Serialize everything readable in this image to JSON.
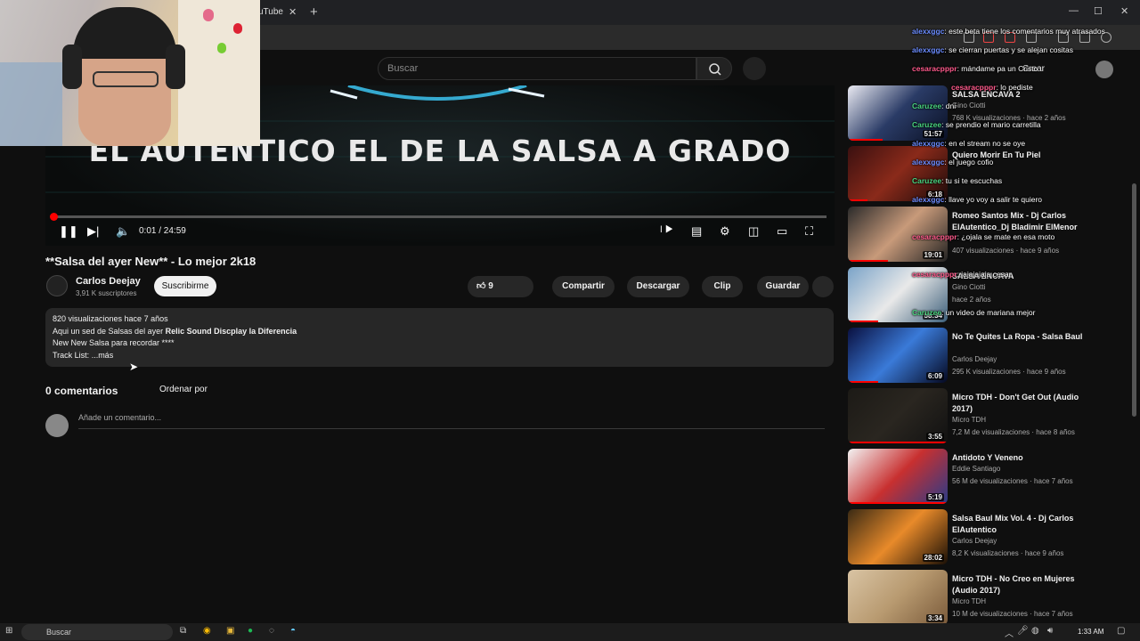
{
  "browser": {
    "tab_title": "uTube",
    "tab_close": "✕",
    "new_tab": "+",
    "win_min": "—",
    "win_max": "☐",
    "win_close": "✕"
  },
  "header": {
    "search_placeholder": "Buscar",
    "create_label": "Crear"
  },
  "player": {
    "banner_text": "EL AUTENTICO EL DE LA SALSA A GRADO",
    "time_display": "0:01 / 24:59",
    "progress_fraction": 0.0007
  },
  "video": {
    "title": "**Salsa del ayer New** - Lo mejor 2k18",
    "channel": "Carlos Deejay",
    "subscribers": "3,91 K suscriptores",
    "subscribe_label": "Suscribirme",
    "like_count": "9",
    "share_label": "Compartir",
    "download_label": "Descargar",
    "clip_label": "Clip",
    "save_label": "Guardar"
  },
  "description": {
    "stats": "820 visualizaciones  hace 7 años",
    "line1_prefix": "Aqui un sed de Salsas del ayer ",
    "line1_bold": "Relic Sound Discplay la Diferencia",
    "line2": "New New Salsa para recordar ****",
    "line3_prefix": "Track List: ",
    "more": "...más"
  },
  "comments": {
    "count_label": "0 comentarios",
    "sort_label": "Ordenar por",
    "input_placeholder": "Añade un comentario..."
  },
  "recommendations": [
    {
      "title": "SALSA ENCAVA 2",
      "channel": "Gino Ciotti",
      "meta": "768 K visualizaciones · hace 2 años",
      "duration": "51:57",
      "progress": 0.35
    },
    {
      "title": "Quiero Morir En Tu Piel",
      "channel": "",
      "meta": "",
      "duration": "6:18",
      "progress": 0.2
    },
    {
      "title": "Romeo Santos Mix - Dj Carlos ElAutentico_Dj Bladimir ElMenor",
      "channel": "",
      "meta": "407 visualizaciones · hace 9 años",
      "duration": "19:01",
      "progress": 0.4
    },
    {
      "title": "SALSA ENCAVA",
      "channel": "Gino Ciotti",
      "meta": "hace 2 años",
      "duration": "58:34",
      "progress": 0.3
    },
    {
      "title": "No Te Quites La Ropa - Salsa Baul",
      "channel": "Carlos Deejay",
      "meta": "295 K visualizaciones · hace 9 años",
      "duration": "6:09",
      "progress": 0.3
    },
    {
      "title": "Micro TDH - Don't Get Out (Audio 2017)",
      "channel": "Micro TDH",
      "meta": "7,2 M de visualizaciones · hace 8 años",
      "duration": "3:55",
      "progress": 1.0
    },
    {
      "title": "Antidoto Y Veneno",
      "channel": "Eddie Santiago",
      "meta": "56 M de visualizaciones · hace 7 años",
      "duration": "5:19",
      "progress": 1.0
    },
    {
      "title": "Salsa Baul Mix Vol. 4 - Dj Carlos ElAutentico",
      "channel": "Carlos Deejay",
      "meta": "8,2 K visualizaciones · hace 9 años",
      "duration": "28:02",
      "progress": 0.0
    },
    {
      "title": "Micro TDH - No Creo en Mujeres (Audio 2017)",
      "channel": "Micro TDH",
      "meta": "10 M de visualizaciones · hace 7 años",
      "duration": "3:34",
      "progress": 0.0
    }
  ],
  "chat": [
    {
      "user": "alexxggc",
      "text": ": este beta tiene los comentarios muy atrasados",
      "color": "u1"
    },
    {
      "user": "alexxggc",
      "text": ": se cierran puertas y se alejan cositas",
      "color": "u1"
    },
    {
      "user": "cesaracpppr",
      "text": ": mándame pa un Cristo",
      "color": "u2"
    },
    {
      "user": "cesaracpppr",
      "text": ": lo pediste",
      "color": "u2"
    },
    {
      "user": "Caruzee",
      "text": ": dni",
      "color": "u3"
    },
    {
      "user": "Caruzee",
      "text": ": se prendio el mario carretilla",
      "color": "u3"
    },
    {
      "user": "alexxggc",
      "text": ": en el stream no se oye",
      "color": "u1"
    },
    {
      "user": "alexxggc",
      "text": ": el juego cofio",
      "color": "u1"
    },
    {
      "user": "Caruzee",
      "text": ": tu si te escuchas",
      "color": "u3"
    },
    {
      "user": "alexxggc",
      "text": ": llave yo voy a salir te quiero",
      "color": "u1"
    },
    {
      "user": "cesaracpppr",
      "text": ": ¿ojala se mate en esa moto",
      "color": "u2"
    },
    {
      "user": "cesaracpppr",
      "text": ": jajajajaja cesar",
      "color": "u2"
    },
    {
      "user": "Caruzee",
      "text": ": un video de mariana mejor",
      "color": "u3"
    }
  ],
  "taskbar": {
    "search_label": "Buscar",
    "time": "1:33 AM"
  }
}
